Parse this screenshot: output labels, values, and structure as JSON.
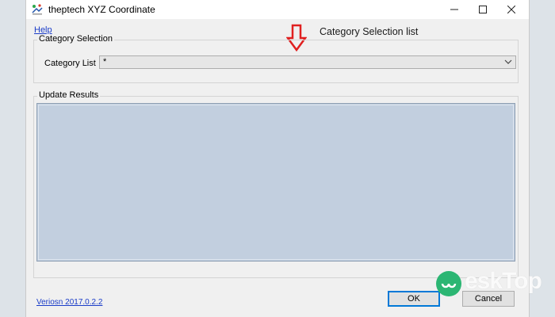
{
  "window": {
    "title": "theptech XYZ Coordinate",
    "minimize_icon": "minimize-icon",
    "maximize_icon": "maximize-icon",
    "close_icon": "close-icon"
  },
  "menu": {
    "help": "Help"
  },
  "annotation": {
    "text": "Category Selection list",
    "arrow_color": "#e02020"
  },
  "category_selection": {
    "group_label": "Category Selection",
    "field_label": "Category List",
    "selected_value": "*"
  },
  "update_results": {
    "group_label": "Update Results"
  },
  "footer": {
    "version": "Veriosn  2017.0.2.2",
    "ok": "OK",
    "cancel": "Cancel"
  },
  "watermark": {
    "text": "eskTop"
  },
  "colors": {
    "results_bg": "#c2cfdf",
    "link": "#1a3cc8",
    "accent": "#0078d7"
  }
}
